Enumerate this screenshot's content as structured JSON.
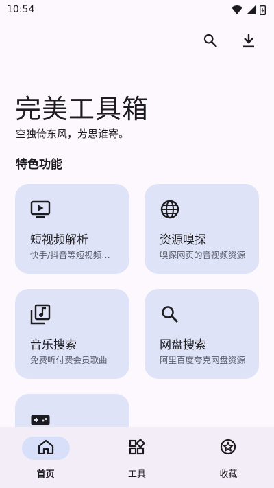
{
  "status_bar": {
    "time": "10:54"
  },
  "header": {
    "title": "完美工具箱",
    "subtitle": "空独倚东风，芳思谁寄。",
    "section_title": "特色功能"
  },
  "cards": [
    {
      "icon": "video-play-icon",
      "title": "短视频解析",
      "desc": "快手/抖音等短视频解析"
    },
    {
      "icon": "globe-icon",
      "title": "资源嗅探",
      "desc": "嗅探网页的音视频资源"
    },
    {
      "icon": "music-library-icon",
      "title": "音乐搜索",
      "desc": "免费听付费会员歌曲"
    },
    {
      "icon": "search-icon",
      "title": "网盘搜索",
      "desc": "阿里百度夸克网盘资源"
    },
    {
      "icon": "gamepad-icon",
      "title": "",
      "desc": ""
    }
  ],
  "bottom_nav": {
    "items": [
      {
        "label": "首页",
        "icon": "home-icon",
        "active": true
      },
      {
        "label": "工具",
        "icon": "widgets-icon",
        "active": false
      },
      {
        "label": "收藏",
        "icon": "star-badge-icon",
        "active": false
      }
    ]
  },
  "colors": {
    "card_bg": "#dfe3f8",
    "nav_bg": "#f3edf7",
    "active_pill": "#d8e0f9",
    "page_bg": "#fdf8fd"
  }
}
